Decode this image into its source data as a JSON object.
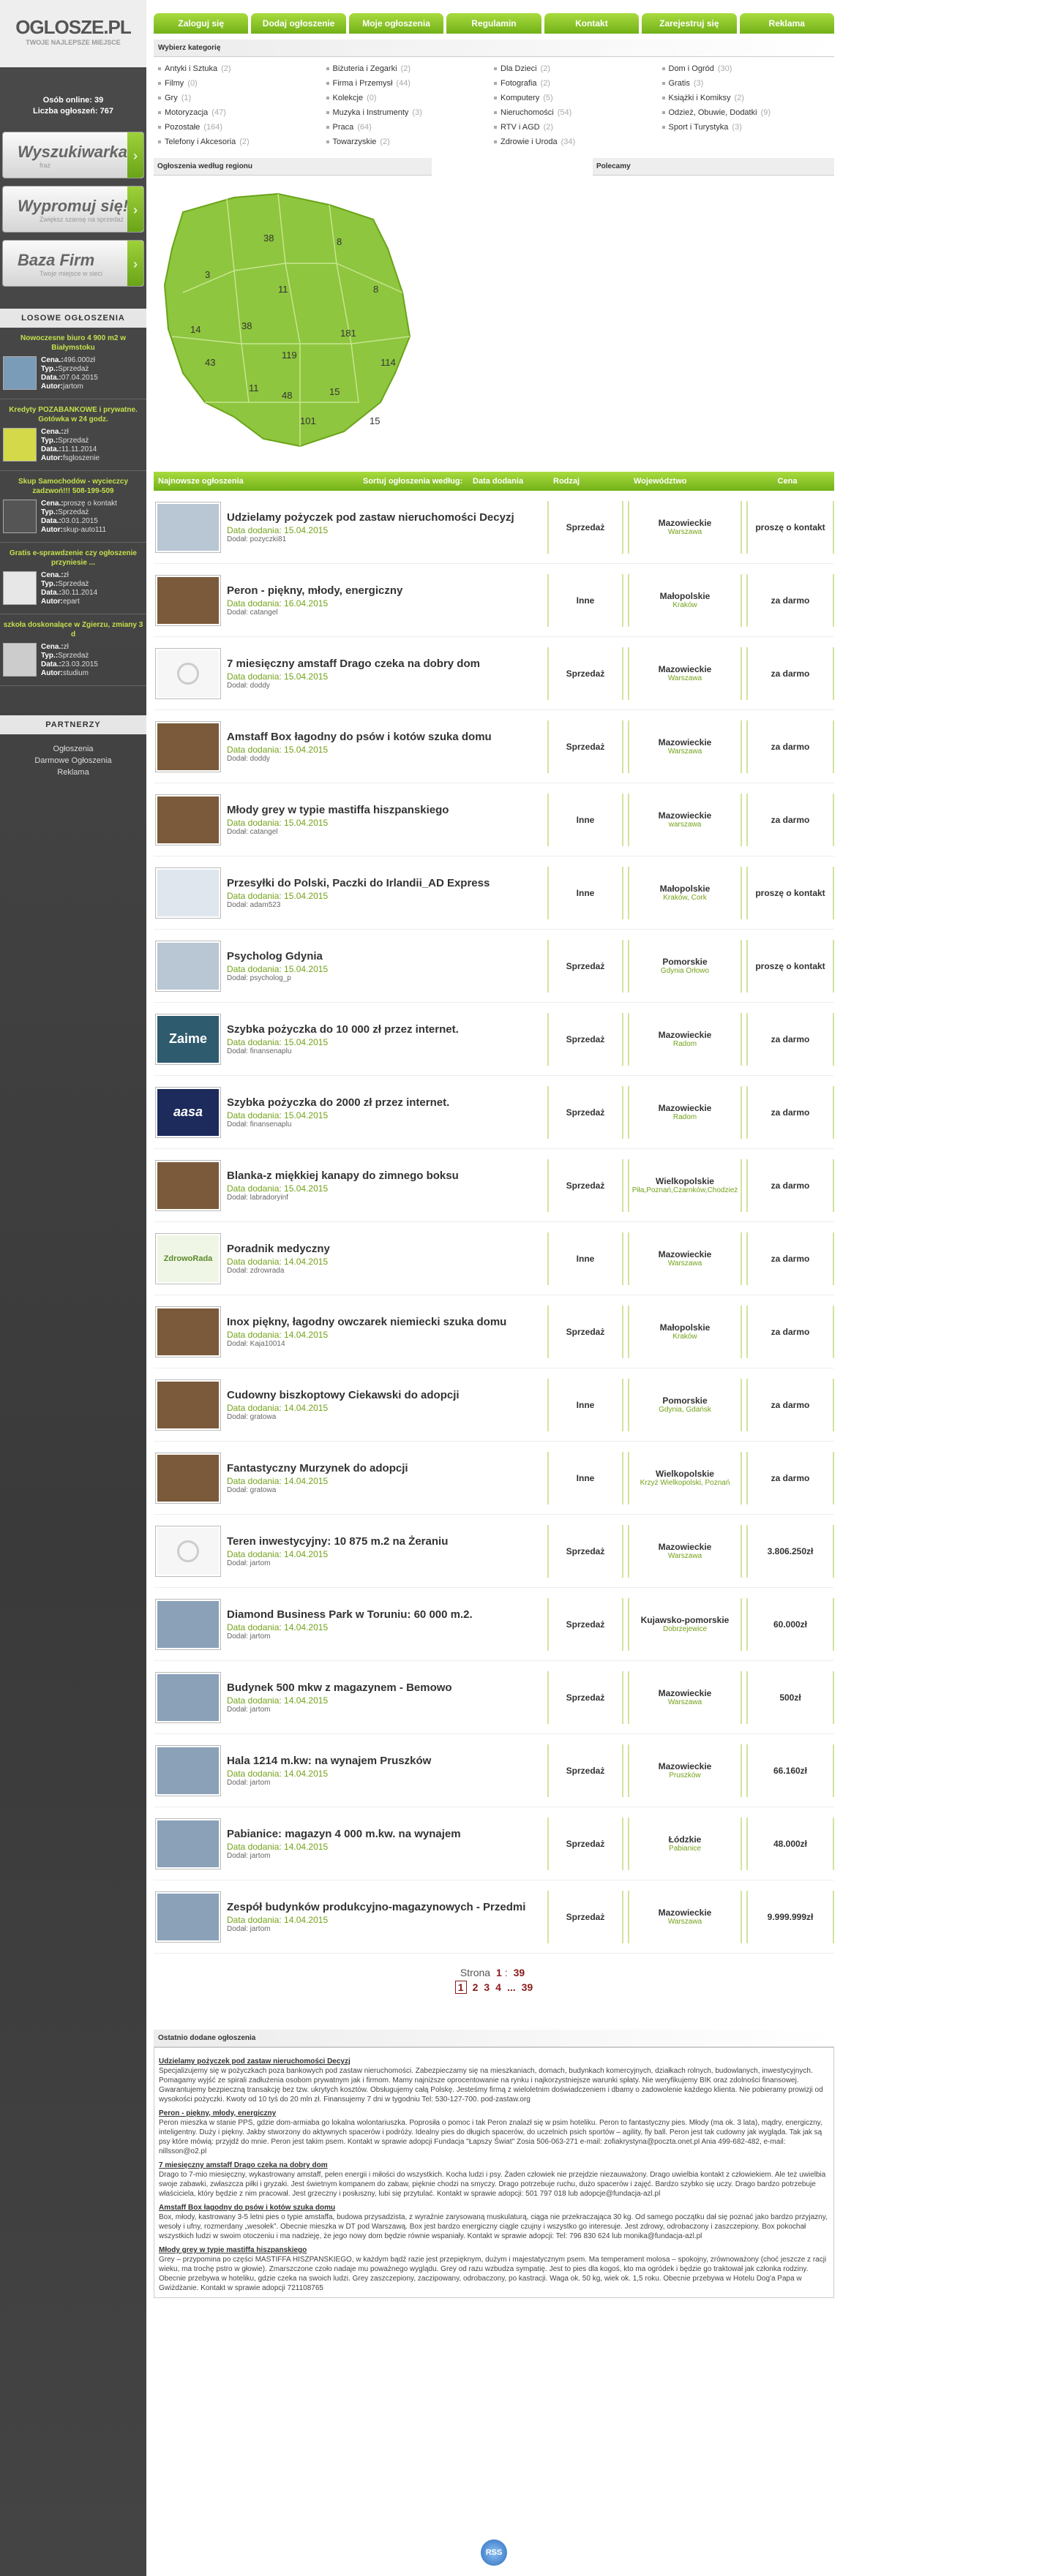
{
  "logo": {
    "title": "OGLOSZE.PL",
    "subtitle": "TWOJE NAJLEPSZE MIEJSCE"
  },
  "stats": {
    "online_label": "Osób online:",
    "online": "39",
    "count_label": "Liczba ogłoszeń:",
    "count": "767"
  },
  "side_buttons": [
    {
      "big": "Wyszukiwarka",
      "small": "fraz"
    },
    {
      "big": "Wypromuj się!",
      "small": "Zwiększ szansę na sprzedaż"
    },
    {
      "big": "Baza Firm",
      "small": "Twoje miejsce w sieci"
    }
  ],
  "losowe_title": "LOSOWE OGŁOSZENIA",
  "losowe": [
    {
      "title": "Nowoczesne biuro 4 900 m2 w Białymstoku",
      "cena": "496.000zł",
      "typ": "Sprzedaż",
      "data": "07.04.2015",
      "autor": "jartom"
    },
    {
      "title": "Kredyty POZABANKOWE i prywatne. Gotówka w 24 godz.",
      "cena": "zł",
      "typ": "Sprzedaż",
      "data": "11.11.2014",
      "autor": "fsgloszenie"
    },
    {
      "title": "Skup Samochodów - wycieczcy zadzwoń!!! 508-199-509",
      "cena": "proszę o kontakt",
      "typ": "Sprzedaż",
      "data": "03.01.2015",
      "autor": "skup-auto111"
    },
    {
      "title": "Gratis e-sprawdzenie czy ogłoszenie przyniesie ...",
      "cena": "zł",
      "typ": "Sprzedaż",
      "data": "30.11.2014",
      "autor": "epart"
    },
    {
      "title": "szkoła doskonalące w Zgierzu, zmiany 3 d",
      "cena": "zł",
      "typ": "Sprzedaż",
      "data": "23.03.2015",
      "autor": "studium"
    }
  ],
  "losowe_labels": {
    "cena": "Cena.:",
    "typ": "Typ.:",
    "data": "Data.:",
    "autor": "Autor:"
  },
  "partners_title": "PARTNERZY",
  "partners": [
    "Ogłoszenia",
    "Darmowe Ogłoszenia",
    "Reklama"
  ],
  "nav": [
    "Zaloguj się",
    "Dodaj ogłoszenie",
    "Moje ogłoszenia",
    "Regulamin",
    "Kontakt",
    "Zarejestruj się",
    "Reklama"
  ],
  "categories_title": "Wybierz kategorię",
  "categories": [
    {
      "name": "Antyki i Sztuka",
      "count": "(2)"
    },
    {
      "name": "Biżuteria i Zegarki",
      "count": "(2)"
    },
    {
      "name": "Dla Dzieci",
      "count": "(2)"
    },
    {
      "name": "Dom i Ogród",
      "count": "(30)"
    },
    {
      "name": "Filmy",
      "count": "(0)"
    },
    {
      "name": "Firma i Przemysł",
      "count": "(44)"
    },
    {
      "name": "Fotografia",
      "count": "(2)"
    },
    {
      "name": "Gratis",
      "count": "(3)"
    },
    {
      "name": "Gry",
      "count": "(1)"
    },
    {
      "name": "Kolekcje",
      "count": "(0)"
    },
    {
      "name": "Komputery",
      "count": "(5)"
    },
    {
      "name": "Książki i Komiksy",
      "count": "(2)"
    },
    {
      "name": "Motoryzacja",
      "count": "(47)"
    },
    {
      "name": "Muzyka i Instrumenty",
      "count": "(3)"
    },
    {
      "name": "Nieruchomości",
      "count": "(54)"
    },
    {
      "name": "Odzież, Obuwie, Dodatki",
      "count": "(9)"
    },
    {
      "name": "Pozostałe",
      "count": "(164)"
    },
    {
      "name": "Praca",
      "count": "(64)"
    },
    {
      "name": "RTV i AGD",
      "count": "(2)"
    },
    {
      "name": "Sport i Turystyka",
      "count": "(3)"
    },
    {
      "name": "Telefony i Akcesoria",
      "count": "(2)"
    },
    {
      "name": "Towarzyskie",
      "count": "(2)"
    },
    {
      "name": "Zdrowie i Uroda",
      "count": "(34)"
    }
  ],
  "region_title": "Ogłoszenia według regionu",
  "polecamy_title": "Polecamy",
  "map_counts": [
    {
      "label": "38"
    },
    {
      "label": "8"
    },
    {
      "label": "3"
    },
    {
      "label": "11"
    },
    {
      "label": "8"
    },
    {
      "label": "14"
    },
    {
      "label": "38"
    },
    {
      "label": "181"
    },
    {
      "label": "119"
    },
    {
      "label": "43"
    },
    {
      "label": "114"
    },
    {
      "label": "11"
    },
    {
      "label": "48"
    },
    {
      "label": "15"
    },
    {
      "label": "101"
    },
    {
      "label": "15"
    }
  ],
  "table_head": {
    "newest": "Najnowsze ogłoszenia",
    "sort": "Sortuj ogłoszenia według:",
    "date": "Data dodania",
    "type": "Rodzaj",
    "region": "Województwo",
    "price": "Cena"
  },
  "ads": [
    {
      "title": "Udzielamy pożyczek pod zastaw nieruchomości Decyzj",
      "date": "Data dodania: 15.04.2015",
      "user": "Dodał: pozyczki81",
      "type": "Sprzedaż",
      "region": "Mazowieckie",
      "city": "Warszawa",
      "price": "proszę o kontakt",
      "thumb": "people"
    },
    {
      "title": "Peron - piękny, młody, energiczny",
      "date": "Data dodania: 16.04.2015",
      "user": "Dodał: catangel",
      "type": "Inne",
      "region": "Małopolskie",
      "city": "Kraków",
      "price": "za darmo",
      "thumb": "dog"
    },
    {
      "title": "7 miesięczny amstaff Drago czeka na dobry dom",
      "date": "Data dodania: 15.04.2015",
      "user": "Dodał: doddy",
      "type": "Sprzedaż",
      "region": "Mazowieckie",
      "city": "Warszawa",
      "price": "za darmo",
      "thumb": "camera"
    },
    {
      "title": "Amstaff Box łagodny do psów i kotów szuka domu",
      "date": "Data dodania: 15.04.2015",
      "user": "Dodał: doddy",
      "type": "Sprzedaż",
      "region": "Mazowieckie",
      "city": "Warszawa",
      "price": "za darmo",
      "thumb": "dog"
    },
    {
      "title": "Młody grey w typie mastiffa hiszpanskiego",
      "date": "Data dodania: 15.04.2015",
      "user": "Dodał: catangel",
      "type": "Inne",
      "region": "Mazowieckie",
      "city": "warszawa",
      "price": "za darmo",
      "thumb": "dog"
    },
    {
      "title": "Przesyłki do Polski, Paczki do Irlandii_AD Express",
      "date": "Data dodania: 15.04.2015",
      "user": "Dodał: adam523",
      "type": "Inne",
      "region": "Małopolskie",
      "city": "Kraków, Cork",
      "price": "proszę o kontakt",
      "thumb": "van"
    },
    {
      "title": "Psycholog Gdynia",
      "date": "Data dodania: 15.04.2015",
      "user": "Dodał: psycholog_p",
      "type": "Sprzedaż",
      "region": "Pomorskie",
      "city": "Gdynia Orłowo",
      "price": "proszę o kontakt",
      "thumb": "people"
    },
    {
      "title": "Szybka pożyczka do 10 000 zł przez internet.",
      "date": "Data dodania: 15.04.2015",
      "user": "Dodał: finansenaplu",
      "type": "Sprzedaż",
      "region": "Mazowieckie",
      "city": "Radom",
      "price": "za darmo",
      "thumb": "zaime"
    },
    {
      "title": "Szybka pożyczka do 2000 zł przez internet.",
      "date": "Data dodania: 15.04.2015",
      "user": "Dodał: finansenaplu",
      "type": "Sprzedaż",
      "region": "Mazowieckie",
      "city": "Radom",
      "price": "za darmo",
      "thumb": "aasa"
    },
    {
      "title": "Blanka-z miękkiej kanapy do zimnego boksu",
      "date": "Data dodania: 15.04.2015",
      "user": "Dodał: labradoryinf",
      "type": "Sprzedaż",
      "region": "Wielkopolskie",
      "city": "Piła,Poznań,Czarnków,Chodzież",
      "price": "za darmo",
      "thumb": "dog"
    },
    {
      "title": "Poradnik medyczny",
      "date": "Data dodania: 14.04.2015",
      "user": "Dodał: zdrowrada",
      "type": "Inne",
      "region": "Mazowieckie",
      "city": "Warszawa",
      "price": "za darmo",
      "thumb": "zdrowo"
    },
    {
      "title": "Inox piękny, łagodny owczarek niemiecki szuka domu",
      "date": "Data dodania: 14.04.2015",
      "user": "Dodał: Kaja10014",
      "type": "Sprzedaż",
      "region": "Małopolskie",
      "city": "Kraków",
      "price": "za darmo",
      "thumb": "dog"
    },
    {
      "title": "Cudowny biszkoptowy Ciekawski do adopcji",
      "date": "Data dodania: 14.04.2015",
      "user": "Dodał: gratowa",
      "type": "Inne",
      "region": "Pomorskie",
      "city": "Gdynia, Gdańsk",
      "price": "za darmo",
      "thumb": "dog"
    },
    {
      "title": "Fantastyczny Murzynek do adopcji",
      "date": "Data dodania: 14.04.2015",
      "user": "Dodał: gratowa",
      "type": "Inne",
      "region": "Wielkopolskie",
      "city": "Krzyż Wielkopolski, Poznań",
      "price": "za darmo",
      "thumb": "dog"
    },
    {
      "title": "Teren inwestycyjny: 10 875 m.2 na Żeraniu",
      "date": "Data dodania: 14.04.2015",
      "user": "Dodał: jartom",
      "type": "Sprzedaż",
      "region": "Mazowieckie",
      "city": "Warszawa",
      "price": "3.806.250zł",
      "thumb": "camera"
    },
    {
      "title": "Diamond Business Park w Toruniu: 60 000 m.2.",
      "date": "Data dodania: 14.04.2015",
      "user": "Dodał: jartom",
      "type": "Sprzedaż",
      "region": "Kujawsko-pomorskie",
      "city": "Dobrzejewice",
      "price": "60.000zł",
      "thumb": "building"
    },
    {
      "title": "Budynek 500 mkw z magazynem - Bemowo",
      "date": "Data dodania: 14.04.2015",
      "user": "Dodał: jartom",
      "type": "Sprzedaż",
      "region": "Mazowieckie",
      "city": "Warszawa",
      "price": "500zł",
      "thumb": "building"
    },
    {
      "title": "Hala 1214 m.kw: na wynajem Pruszków",
      "date": "Data dodania: 14.04.2015",
      "user": "Dodał: jartom",
      "type": "Sprzedaż",
      "region": "Mazowieckie",
      "city": "Pruszków",
      "price": "66.160zł",
      "thumb": "building"
    },
    {
      "title": "Pabianice: magazyn 4 000 m.kw. na wynajem",
      "date": "Data dodania: 14.04.2015",
      "user": "Dodał: jartom",
      "type": "Sprzedaż",
      "region": "Łódzkie",
      "city": "Pabianice",
      "price": "48.000zł",
      "thumb": "building"
    },
    {
      "title": "Zespół budynków produkcyjno-magazynowych - Przedmi",
      "date": "Data dodania: 14.04.2015",
      "user": "Dodał: jartom",
      "type": "Sprzedaż",
      "region": "Mazowieckie",
      "city": "Warszawa",
      "price": "9.999.999zł",
      "thumb": "building"
    }
  ],
  "pagination": {
    "label": "Strona",
    "current": "1",
    "sep": ":",
    "total": "39",
    "pages": [
      "1",
      "2",
      "3",
      "4",
      "...",
      "39"
    ]
  },
  "recent_title": "Ostatnio dodane ogłoszenia",
  "recent": [
    {
      "title": "Udzielamy pożyczek pod zastaw nieruchomości Decyzj",
      "body": "Specjalizujemy się w pożyczkach poza bankowych pod zastaw nieruchomości. Zabezpieczamy się na mieszkaniach, domach, budynkach komercyjnych, działkach rolnych, budowlanych, inwestycyjnych. Pomagamy wyjść ze spirali zadłużenia osobom prywatnym jak i firmom. Mamy najniższe oprocentowanie na rynku i najkorzystniejsze warunki spłaty. Nie weryfikujemy BIK oraz zdolności finansowej. Gwarantujemy bezpieczną transakcję bez tzw. ukrytych kosztów. Obsługujemy całą Polskę. Jesteśmy firmą z wieloletnim doświadczeniem i dbamy o zadowolenie każdego klienta. Nie pobieramy prowizji od wysokości pożyczki. Kwoty od 10 tyś do 20 mln zł. Finansujemy 7 dni w tygodniu Tel: 530-127-700. pod-zastaw.org"
    },
    {
      "title": "Peron - piękny, młody, energiczny",
      "body": "Peron mieszka w stanie PPS, gdzie dom-armiaba go lokalna wolontariuszka. Poprosiła o pomoc i tak Peron znalazł się w psim hoteliku. Peron to fantastyczny pies. Młody (ma ok. 3 lata), mądry, energiczny, inteligentny. Duży i piękny. Jakby stworzony do aktywnych spacerów i podróży. Idealny pies do długich spacerów, do uczelnich psich sportów – agility, fly ball. Peron jest tak cudowny jak wygląda. Tak jak są psy które mówią: przyjdź do mnie. Peron jest takim psem. Kontakt w sprawie adopcji Fundacja \"Łapszy Świat\" Zosia 506-063-271 e-mail: zofiakrystyna@poczta.onet.pl Ania 499-682-482, e-mail: nillsson@o2.pl"
    },
    {
      "title": "7 miesięczny amstaff Drago czeka na dobry dom",
      "body": "Drago to 7-mio miesięczny, wykastrowany amstaff, pełen energii i miłości do wszystkich. Kocha ludzi i psy. Żaden człowiek nie przejdzie niezauważony. Drago uwielbia kontakt z człowiekiem. Ale też uwielbia swoje zabawki, zwłaszcza piłki i gryzaki. Jest świetnym kompanem do zabaw, pięknie chodzi na smyczy. Drago potrzebuje ruchu, dużo spacerów i zajęć. Bardzo szybko się uczy. Drago bardzo potrzebuje właściciela, który będzie z nim pracował. Jest grzeczny i posłuszny, lubi się przytulać. Kontakt w sprawie adopcji: 501 797 018 lub adopcje@fundacja-azl.pl"
    },
    {
      "title": "Amstaff Box łagodny do psów i kotów szuka domu",
      "body": "Box, młody, kastrowany 3-5 letni pies o typie amstaffa, budowa przysadzista, z wyraźnie zarysowaną muskulaturą, ciąga nie przekraczająca 30 kg. Od samego początku dał się poznać jako bardzo przyjazny, wesoły i ufny, rozmerdany „wesołek”. Obecnie mieszka w DT pod Warszawą. Box jest bardzo energiczny ciągle czujny i wszystko go interesuje. Jest zdrowy, odrobaczony i zaszczepiony. Box pokochał wszystkich ludzi w swoim otoczeniu i ma nadzieję, że jego nowy dom będzie równie wspaniały. Kontakt w sprawie adopcji: Tel: 796 830 624 lub monika@fundacja-azl.pl"
    },
    {
      "title": "Młody grey w typie mastiffa hiszpanskiego",
      "body": "Grey – przypomina po części MASTIFFA HISZPANSKIEGO, w każdym bądź razie jest przepięknym, dużym i majestatycznym psem. Ma temperament molosa – spokojny, zrównoważony (choć jeszcze z racji wieku, ma trochę pstro w głowie). Zmarszczone czoło nadaje mu poważnego wyglądu. Grey od razu wzbudza sympatię. Jest to pies dla kogoś, kto ma ogródek i będzie go traktował jak członka rodziny. Obecnie przebywa w hoteliku, gdzie czeka na swoich ludzi. Grey zaszczepiony, zaczipowany, odrobaczony, po kastracji. Waga ok. 50 kg, wiek ok. 1,5 roku. Obecnie przebywa w Hotelu Dog'a Papa w Gwiżdżanie. Kontakt w sprawie adopcji 721108765"
    }
  ],
  "footer_icon": "rss-icon",
  "footer_label": "RSS"
}
